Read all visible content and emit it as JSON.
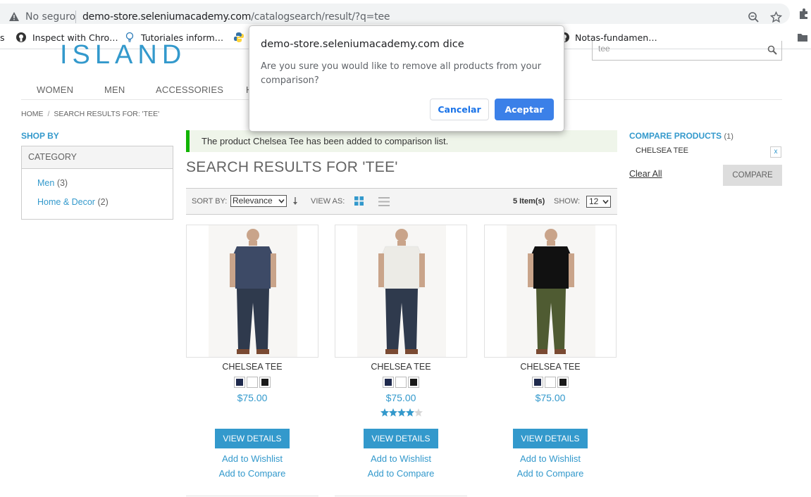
{
  "browser": {
    "security_label": "No seguro",
    "url_host": "demo-store.seleniumacademy.com",
    "url_path": "/catalogsearch/result/?q=tee",
    "bookmarks": [
      {
        "label": "s",
        "icon": "bookmark-fragment"
      },
      {
        "label": "Inspect with Chro…",
        "icon": "github-icon"
      },
      {
        "label": "Tutoriales inform…",
        "icon": "lightbulb-icon"
      },
      {
        "label": "Notas-fundamen…",
        "icon": "github-icon"
      }
    ]
  },
  "header": {
    "logo_text": "ISLAND",
    "search_value": "tee",
    "nav": [
      "WOMEN",
      "MEN",
      "ACCESSORIES",
      "H"
    ]
  },
  "breadcrumb": {
    "home": "HOME",
    "sep": "/",
    "current": "SEARCH RESULTS FOR: 'TEE'"
  },
  "sidebar": {
    "shop_by": "SHOP BY",
    "category_title": "CATEGORY",
    "categories": [
      {
        "name": "Men",
        "count": "(3)"
      },
      {
        "name": "Home & Decor",
        "count": "(2)"
      }
    ]
  },
  "main": {
    "success_message": "The product Chelsea Tee has been added to comparison list.",
    "title": "SEARCH RESULTS FOR 'TEE'",
    "toolbar": {
      "sort_by_label": "SORT BY:",
      "sort_value": "Relevance",
      "view_as_label": "VIEW AS:",
      "items_count": "5 Item(s)",
      "show_label": "SHOW:",
      "show_value": "12"
    },
    "products": [
      {
        "name": "CHELSEA TEE",
        "price": "$75.00",
        "shirt_color": "#3d4a66",
        "pants_color": "#2f3a4d",
        "rating_fraction": null,
        "view_label": "VIEW DETAILS",
        "wishlist_label": "Add to Wishlist",
        "compare_label": "Add to Compare"
      },
      {
        "name": "CHELSEA TEE",
        "price": "$75.00",
        "shirt_color": "#ecebe6",
        "pants_color": "#2f3a4d",
        "rating_fraction": 0.8,
        "view_label": "VIEW DETAILS",
        "wishlist_label": "Add to Wishlist",
        "compare_label": "Add to Compare"
      },
      {
        "name": "CHELSEA TEE",
        "price": "$75.00",
        "shirt_color": "#111111",
        "pants_color": "#4f5b32",
        "rating_fraction": null,
        "view_label": "VIEW DETAILS",
        "wishlist_label": "Add to Wishlist",
        "compare_label": "Add to Compare"
      }
    ],
    "swatch_colors": [
      "#1f2a4d",
      "#ffffff",
      "#1a1a1a"
    ]
  },
  "compare": {
    "title": "COMPARE PRODUCTS",
    "count": "(1)",
    "item": "CHELSEA TEE",
    "remove": "x",
    "clear_all": "Clear All",
    "button": "COMPARE"
  },
  "dialog": {
    "title": "demo-store.seleniumacademy.com dice",
    "message": "Are you sure you would like to remove all products from your comparison?",
    "cancel": "Cancelar",
    "accept": "Aceptar"
  },
  "colors": {
    "accent": "#3399cc",
    "success": "#11b400",
    "dialog_primary": "#3b80e8"
  }
}
